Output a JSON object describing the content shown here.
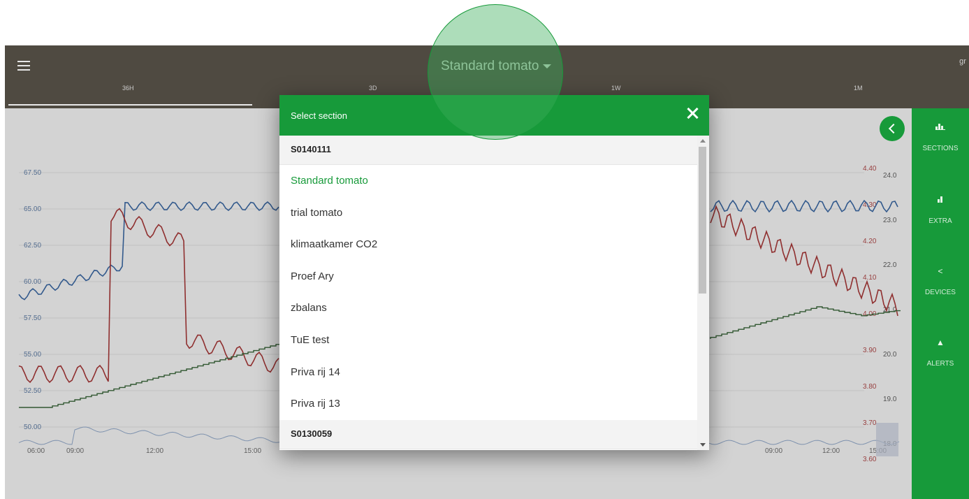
{
  "header": {
    "title": "Standard tomato",
    "brand": "gr",
    "tabs": [
      {
        "label": "36H",
        "active": true
      },
      {
        "label": "3D",
        "active": false
      },
      {
        "label": "1W",
        "active": false
      },
      {
        "label": "1M",
        "active": false
      }
    ]
  },
  "chart": {
    "left_axis_ticks": [
      "67.50",
      "65.00",
      "62.50",
      "60.00",
      "57.50",
      "55.00",
      "52.50",
      "50.00"
    ],
    "right_axis_red_ticks": [
      "4.40",
      "4.30",
      "4.20",
      "4.10",
      "4.00",
      "3.90",
      "3.80",
      "3.70",
      "3.60"
    ],
    "right_axis_dark_ticks": [
      "24.0",
      "23.0",
      "22.0",
      "21.0",
      "20.0",
      "19.0",
      "18.0"
    ],
    "time_labels": [
      "06:00",
      "09:00",
      "12:00",
      "15:00",
      "09:00",
      "12:00",
      "15:00"
    ],
    "series_colors": {
      "blue": "#2d5fa0",
      "red": "#a52a2a",
      "green": "#2e5e2e"
    }
  },
  "sidebar": {
    "items": [
      {
        "label": "SECTIONS",
        "icon": "bar-chart-icon"
      },
      {
        "label": "EXTRA",
        "icon": "bar-chart-small-icon"
      },
      {
        "label": "DEVICES",
        "icon": "share-icon"
      },
      {
        "label": "ALERTS",
        "icon": "bell-icon"
      }
    ]
  },
  "modal": {
    "title": "Select section",
    "groups": [
      {
        "name": "S0140111",
        "items": [
          "Standard tomato",
          "trial tomato",
          "klimaatkamer CO2",
          "Proef Ary",
          "zbalans",
          "TuE test",
          "Priva rij 14",
          "Priva rij 13"
        ]
      },
      {
        "name": "S0130059",
        "items": []
      }
    ],
    "selected": "Standard tomato"
  },
  "colors": {
    "accent": "#179a3a",
    "topbar": "#4f4a41"
  }
}
